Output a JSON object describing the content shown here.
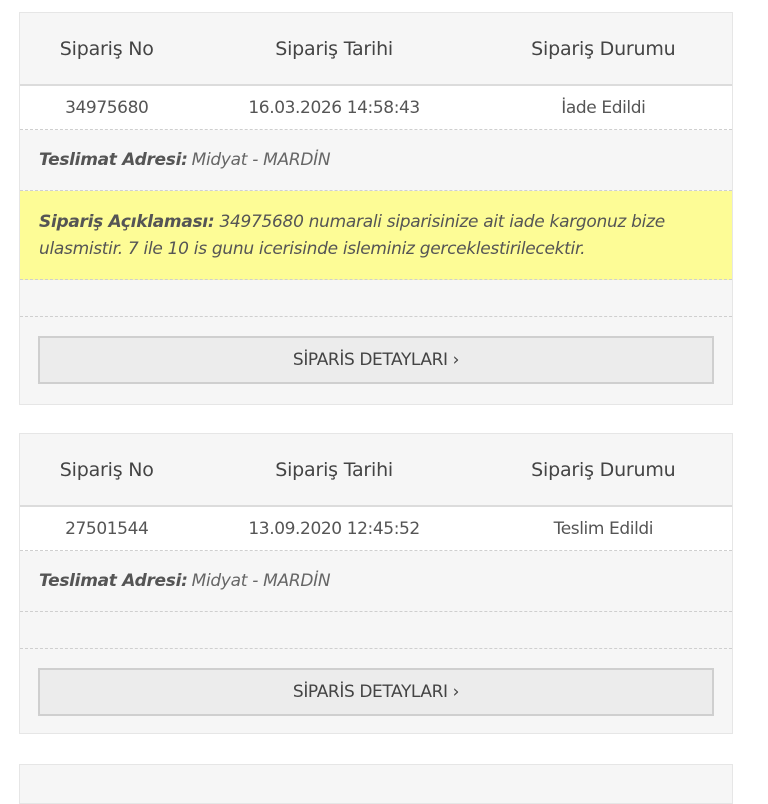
{
  "headers": {
    "order_no": "Sipariş No",
    "order_date": "Sipariş Tarihi",
    "order_status": "Sipariş Durumu"
  },
  "orders": [
    {
      "order_no": "34975680",
      "order_date": "16.03.2026 14:58:43",
      "status": "İade Edildi",
      "address_label": "Teslimat Adresi:",
      "address": "Midyat - MARDİN",
      "note_label": "Sipariş Açıklaması:",
      "note_text": "34975680 numarali siparisinize ait iade kargonuz bize ulasmistir. 7 ile 10 is gunu icerisinde isleminiz gerceklestirilecektir.",
      "details_button": "SİPARİS DETAYLARI ›"
    },
    {
      "order_no": "27501544",
      "order_date": "13.09.2020 12:45:52",
      "status": "Teslim Edildi",
      "address_label": "Teslimat Adresi:",
      "address": "Midyat - MARDİN",
      "details_button": "SİPARİS DETAYLARI ›"
    }
  ],
  "colors": {
    "note_highlight": "#fdfc96",
    "card_background": "#f6f6f6"
  }
}
